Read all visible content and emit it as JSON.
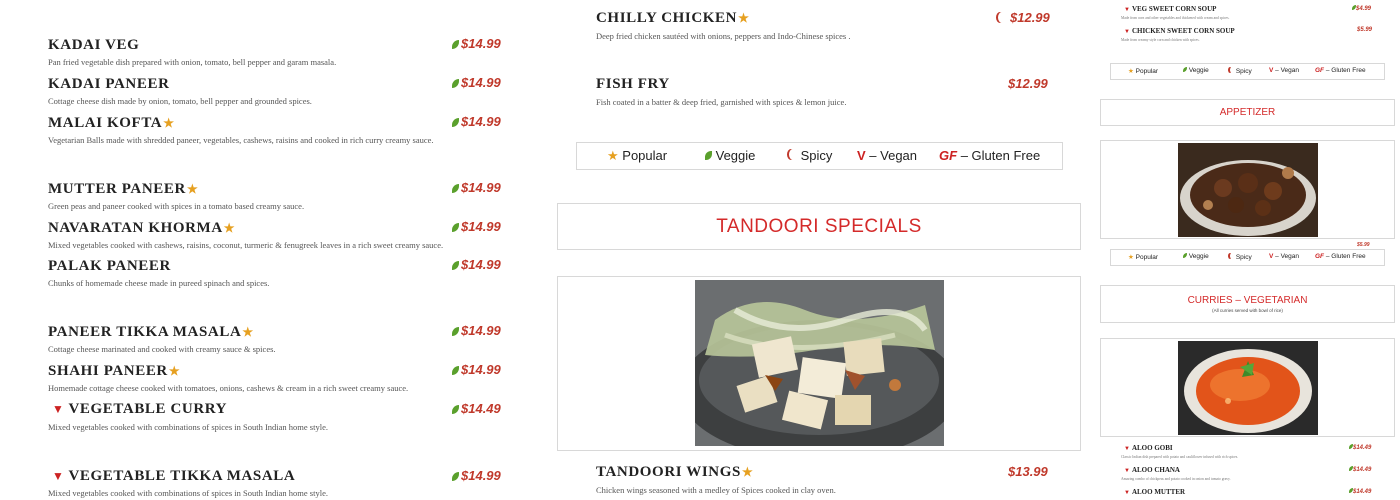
{
  "curries_veg": [
    {
      "name": "KADAI VEG",
      "desc": "Pan fried vegetable dish prepared with onion, tomato, bell pepper and garam masala.",
      "price": "$14.99",
      "popular": false,
      "vegan": false
    },
    {
      "name": "KADAI PANEER",
      "desc": "Cottage cheese dish made by onion, tomato, bell pepper and grounded spices.",
      "price": "$14.99",
      "popular": false,
      "vegan": false
    },
    {
      "name": "MALAI KOFTA",
      "desc": "Vegetarian Balls made with shredded paneer, vegetables, cashews, raisins and cooked in rich curry creamy sauce.",
      "price": "$14.99",
      "popular": true,
      "vegan": false
    },
    {
      "name": "MUTTER PANEER",
      "desc": "Green peas and paneer cooked with spices in a tomato based creamy sauce.",
      "price": "$14.99",
      "popular": true,
      "vegan": false
    },
    {
      "name": "NAVARATAN KHORMA",
      "desc": "Mixed vegetables cooked with cashews, raisins, coconut, turmeric & fenugreek leaves in a rich sweet creamy sauce.",
      "price": "$14.99",
      "popular": true,
      "vegan": false
    },
    {
      "name": "PALAK PANEER",
      "desc": "Chunks of homemade cheese made in pureed spinach and spices.",
      "price": "$14.99",
      "popular": false,
      "vegan": false
    },
    {
      "name": "PANEER TIKKA MASALA",
      "desc": "Cottage cheese marinated and cooked with creamy sauce & spices.",
      "price": "$14.99",
      "popular": true,
      "vegan": false
    },
    {
      "name": "SHAHI PANEER",
      "desc": "Homemade cottage cheese cooked with tomatoes, onions, cashews & cream in a rich sweet creamy sauce.",
      "price": "$14.99",
      "popular": true,
      "vegan": false
    },
    {
      "name": "VEGETABLE CURRY",
      "desc": "Mixed vegetables cooked with combinations of spices in South Indian home style.",
      "price": "$14.49",
      "popular": false,
      "vegan": true
    },
    {
      "name": "VEGETABLE TIKKA MASALA",
      "desc": "Mixed vegetables cooked with combinations of spices in South Indian home style.",
      "price": "$14.99",
      "popular": false,
      "vegan": true
    }
  ],
  "middle": {
    "chilly_chicken": {
      "name": "CHILLY CHICKEN",
      "desc": "Deep fried chicken sautéed with onions, peppers and Indo-Chinese spices .",
      "price": "$12.99"
    },
    "fish_fry": {
      "name": "FISH FRY",
      "desc": "Fish coated in a batter & deep fried, garnished with spices & lemon juice.",
      "price": "$12.99"
    },
    "section_title": "TANDOORI SPECIALS",
    "tandoori_wings": {
      "name": "TANDOORI WINGS",
      "desc": "Chicken wings seasoned with a medley of Spices cooked in clay oven.",
      "price": "$13.99"
    }
  },
  "legend": {
    "popular": "Popular",
    "veggie": "Veggie",
    "spicy": "Spicy",
    "vegan_mark": "V",
    "vegan": "– Vegan",
    "gf_mark": "GF",
    "gluten_free": "– Gluten Free"
  },
  "right": {
    "soups": [
      {
        "name": "VEG SWEET CORN SOUP",
        "desc": "Made from corn and other vegetables and thickened with cream and spices.",
        "price": "$4.99"
      },
      {
        "name": "CHICKEN SWEET CORN SOUP",
        "desc": "Made from creamy style corn and chicken with spices.",
        "price": "$5.99"
      }
    ],
    "appetizer_title": "APPETIZER",
    "hidden_price": "$5.99",
    "curries_title": "CURRIES – VEGETARIAN",
    "curries_subtitle": "(All curries served with bowl of rice)",
    "curries": [
      {
        "name": "ALOO GOBI",
        "desc": "Classic Indian dish prepared with potato and cauliflower infused with rich spices.",
        "price": "$14.49"
      },
      {
        "name": "ALOO CHANA",
        "desc": "Amazing combo of chickpeas and potato cooked in onion and tomato gravy.",
        "price": "$14.49"
      },
      {
        "name": "ALOO MUTTER",
        "desc": "",
        "price": "$14.49"
      }
    ]
  },
  "colors": {
    "accent_red": "#d42a2a",
    "price_red": "#c0392b",
    "star": "#e6a020",
    "leaf": "#5aa02c"
  }
}
